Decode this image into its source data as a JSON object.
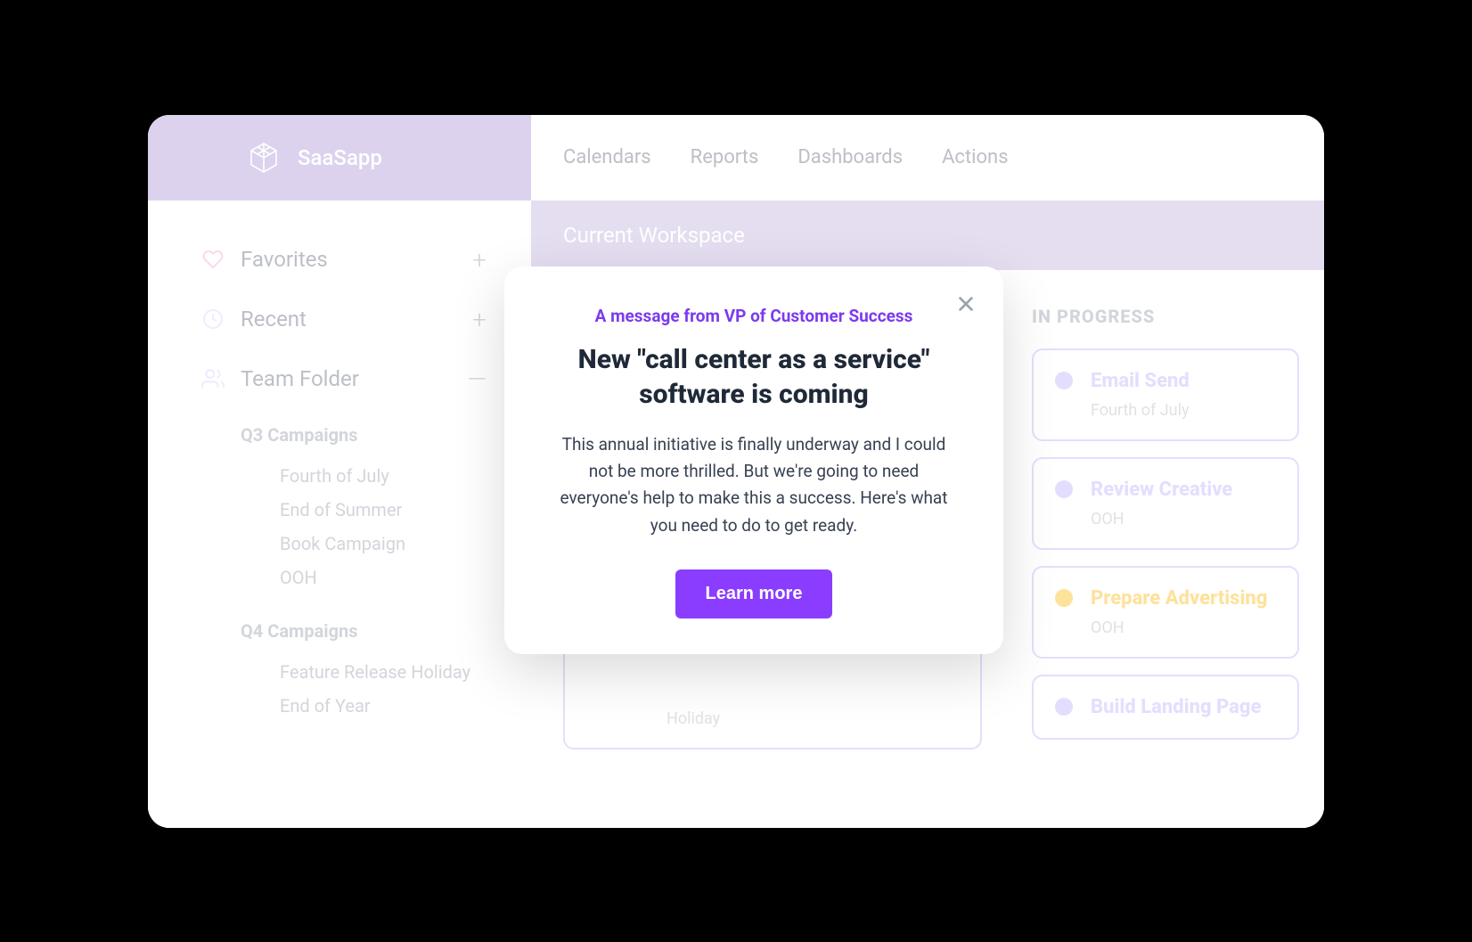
{
  "app": {
    "name": "SaaSapp"
  },
  "nav": {
    "items": [
      {
        "label": "Calendars"
      },
      {
        "label": "Reports"
      },
      {
        "label": "Dashboards"
      },
      {
        "label": "Actions"
      }
    ]
  },
  "workspace": {
    "label": "Current Workspace"
  },
  "sidebar": {
    "sections": [
      {
        "label": "Favorites",
        "action": "+"
      },
      {
        "label": "Recent",
        "action": "+"
      },
      {
        "label": "Team Folder",
        "action": "—"
      }
    ],
    "groups": [
      {
        "title": "Q3 Campaigns",
        "items": [
          {
            "label": "Fourth of July"
          },
          {
            "label": "End of Summer"
          },
          {
            "label": "Book Campaign"
          },
          {
            "label": "OOH"
          }
        ]
      },
      {
        "title": "Q4 Campaigns",
        "items": [
          {
            "label": "Feature Release Holiday"
          },
          {
            "label": "End of Year"
          }
        ]
      }
    ]
  },
  "board": {
    "columns": [
      {
        "title": "",
        "cards": [
          {
            "title": "",
            "sub": "Holiday",
            "dot": ""
          }
        ]
      },
      {
        "title": "IN PROGRESS",
        "cards": [
          {
            "title": "Email Send",
            "sub": "Fourth of July",
            "dot": "purple"
          },
          {
            "title": "Review Creative",
            "sub": "OOH",
            "dot": "purple"
          },
          {
            "title": "Prepare Advertising",
            "sub": "OOH",
            "dot": "orange"
          },
          {
            "title": "Build Landing Page",
            "sub": "",
            "dot": "purple"
          }
        ]
      }
    ]
  },
  "modal": {
    "eyebrow": "A message from VP of Customer Success",
    "title": "New \"call center as a service\" software is coming",
    "body": "This annual initiative is finally underway and I could not be more thrilled. But we're going to need everyone's help to make this a success. Here's what you need to do to get ready.",
    "cta": "Learn more"
  }
}
